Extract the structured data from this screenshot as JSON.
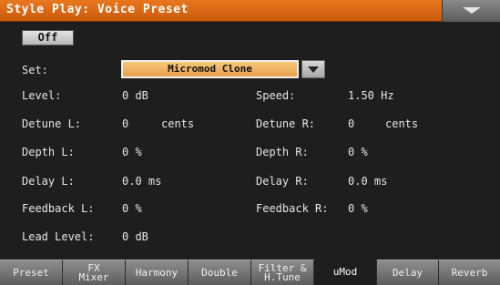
{
  "window": {
    "title": "Style Play: Voice Preset",
    "menu_icon": "chevron-down-icon"
  },
  "toggle": {
    "off_label": "Off"
  },
  "set": {
    "label": "Set:",
    "value": "Micromod Clone"
  },
  "params": {
    "level": {
      "label": "Level:",
      "value": "0 dB"
    },
    "speed": {
      "label": "Speed:",
      "value": "1.50 Hz"
    },
    "detune_l": {
      "label": "Detune L:",
      "value": "0",
      "unit": "cents"
    },
    "detune_r": {
      "label": "Detune R:",
      "value": "0",
      "unit": "cents"
    },
    "depth_l": {
      "label": "Depth L:",
      "value": "0 %"
    },
    "depth_r": {
      "label": "Depth R:",
      "value": "0 %"
    },
    "delay_l": {
      "label": "Delay L:",
      "value": "0.0 ms"
    },
    "delay_r": {
      "label": "Delay R:",
      "value": "0.0 ms"
    },
    "feedback_l": {
      "label": "Feedback L:",
      "value": "0 %"
    },
    "feedback_r": {
      "label": "Feedback R:",
      "value": "0 %"
    },
    "lead_level": {
      "label": "Lead Level:",
      "value": "0 dB"
    }
  },
  "tabs": [
    {
      "label": "Preset"
    },
    {
      "line1": "FX",
      "line2": "Mixer"
    },
    {
      "label": "Harmony"
    },
    {
      "label": "Double"
    },
    {
      "line1": "Filter &",
      "line2": "H.Tune"
    },
    {
      "label": "uMod",
      "active": true
    },
    {
      "label": "Delay"
    },
    {
      "label": "Reverb"
    }
  ],
  "colors": {
    "title_bar": "#d8650f",
    "set_field": "#f0b35e",
    "background": "#1e1e1e"
  }
}
